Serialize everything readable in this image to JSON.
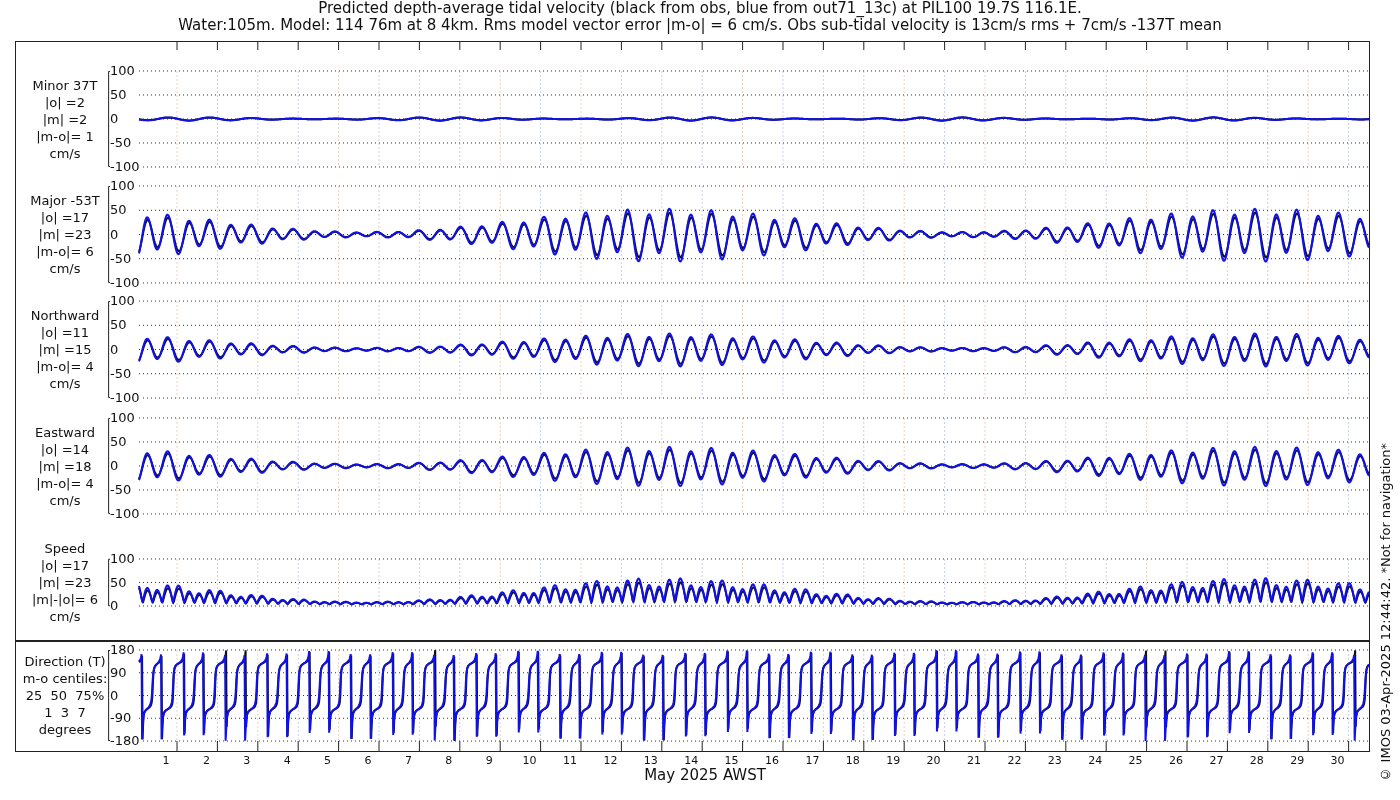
{
  "title": [
    "Predicted depth-average tidal velocity (black from obs, blue from out71_13c) at PIL100 19.7S 116.1E.",
    "Water:105m. Model: 114 76m at 8 4km. Rms model vector error |m-o| = 6 cm/s. Obs sub-tidal velocity is 13cm/s rms + 7cm/s -137T mean"
  ],
  "panels": [
    {
      "kind": "signed",
      "title": "Minor 37T",
      "stats": [
        "|o| =2",
        "|m| =2",
        "|m-o|= 1"
      ],
      "unit": "cm/s",
      "yticks": [
        "100",
        "50",
        "0",
        "-50",
        "-100"
      ]
    },
    {
      "kind": "signed",
      "title": "Major -53T",
      "stats": [
        "|o| =17",
        "|m| =23",
        "|m-o|= 6"
      ],
      "unit": "cm/s",
      "yticks": [
        "100",
        "50",
        "0",
        "-50",
        "-100"
      ]
    },
    {
      "kind": "signed",
      "title": "Northward",
      "stats": [
        "|o| =11",
        "|m| =15",
        "|m-o|= 4"
      ],
      "unit": "cm/s",
      "yticks": [
        "100",
        "50",
        "0",
        "-50",
        "-100"
      ]
    },
    {
      "kind": "signed",
      "title": "Eastward",
      "stats": [
        "|o| =14",
        "|m| =18",
        "|m-o|= 4"
      ],
      "unit": "cm/s",
      "yticks": [
        "100",
        "50",
        "0",
        "-50",
        "-100"
      ]
    },
    {
      "kind": "speed",
      "title": "Speed",
      "stats": [
        "|o| =17",
        "|m| =23",
        "|m|-|o|= 6"
      ],
      "unit": "cm/s",
      "yticks": [
        "100",
        "50",
        "0"
      ]
    },
    {
      "kind": "direction",
      "title": "Direction (T)",
      "stats": [
        "m-o centiles:",
        "25  50  75%",
        "1  3  7"
      ],
      "unit": "degrees",
      "yticks": [
        "180",
        "90",
        "0",
        "-90",
        "-180"
      ]
    }
  ],
  "x_axis": {
    "day_labels": [
      "1",
      "2",
      "3",
      "4",
      "5",
      "6",
      "7",
      "8",
      "9",
      "10",
      "11",
      "12",
      "13",
      "14",
      "15",
      "16",
      "17",
      "18",
      "19",
      "20",
      "21",
      "22",
      "23",
      "24",
      "25",
      "26",
      "27",
      "28",
      "29",
      "30"
    ],
    "label": "May 2025 AWST"
  },
  "side_note": "© IMOS 03-Apr-2025 12:44:42. *Not for navigation*"
}
